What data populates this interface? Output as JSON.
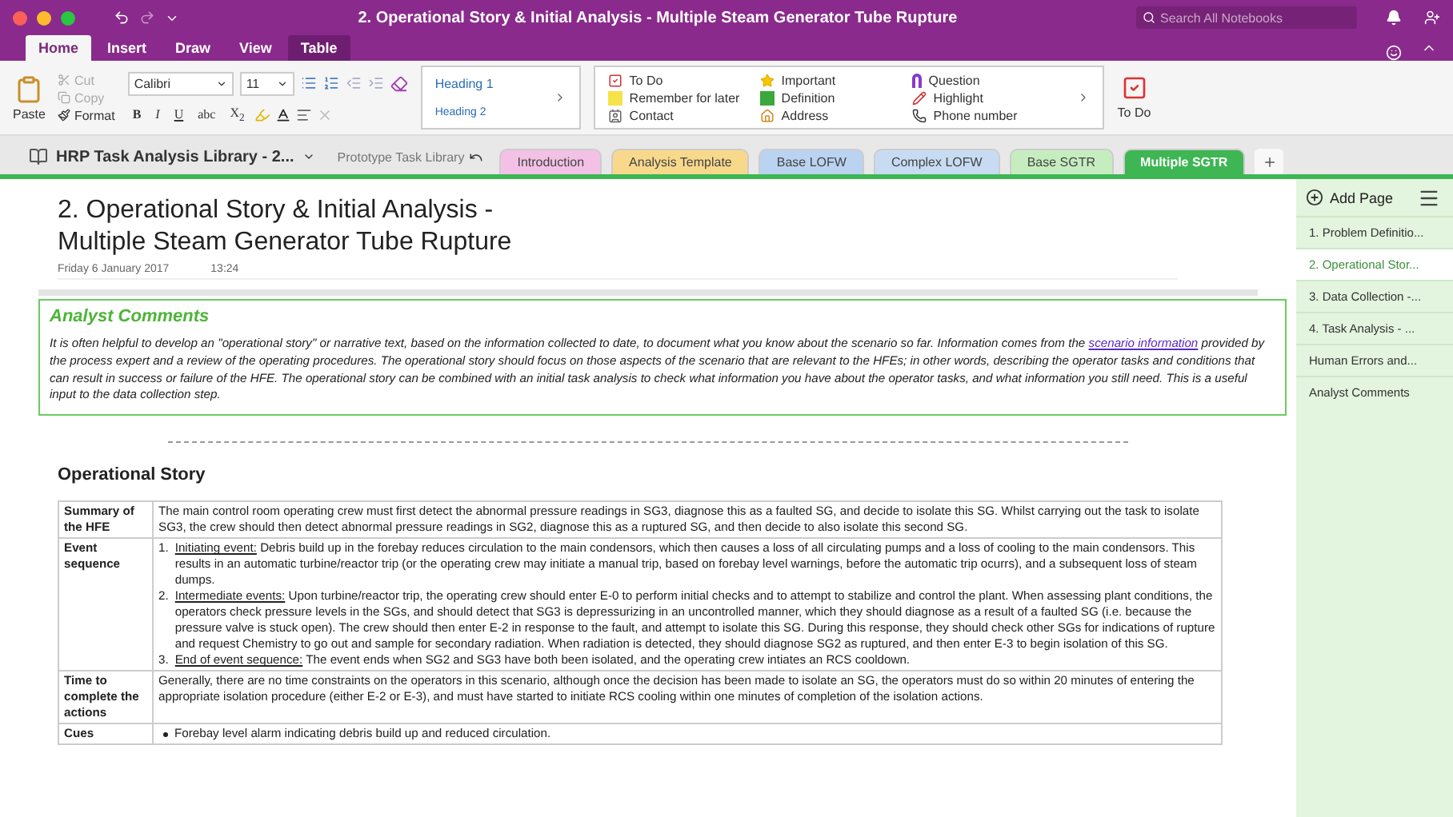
{
  "window": {
    "title": "2. Operational Story & Initial Analysis - Multiple Steam Generator Tube Rupture",
    "search_placeholder": "Search All Notebooks"
  },
  "ribbon_tabs": [
    {
      "label": "Home",
      "selected": true
    },
    {
      "label": "Insert",
      "selected": false
    },
    {
      "label": "Draw",
      "selected": false
    },
    {
      "label": "View",
      "selected": false
    },
    {
      "label": "Table",
      "selected": false,
      "kind": "contextual"
    }
  ],
  "clipboard": {
    "paste": "Paste",
    "cut": "Cut",
    "copy": "Copy",
    "format": "Format"
  },
  "font": {
    "name": "Calibri",
    "size": "11",
    "buttons": [
      "B",
      "I",
      "U",
      "abc",
      "X$_{2}$"
    ]
  },
  "styles": [
    "Heading 1",
    "Heading 2"
  ],
  "tags": [
    {
      "label": "To Do"
    },
    {
      "label": "Remember for later"
    },
    {
      "label": "Contact"
    },
    {
      "label": "Important"
    },
    {
      "label": "Definition"
    },
    {
      "label": "Address"
    },
    {
      "label": "Question"
    },
    {
      "label": "Highlight"
    },
    {
      "label": "Phone number"
    }
  ],
  "todo_button": "To Do",
  "notebook": {
    "name": "HRP Task Analysis Library - 2...",
    "section_group": "Prototype Task Library"
  },
  "sections": [
    {
      "label": "Introduction",
      "color": "#f3c1e6",
      "selected": false
    },
    {
      "label": "Analysis Template",
      "color": "#f8d98c",
      "selected": false
    },
    {
      "label": "Base LOFW",
      "color": "#b9d3f0",
      "selected": false
    },
    {
      "label": "Complex LOFW",
      "color": "#c7dcf3",
      "selected": false
    },
    {
      "label": "Base SGTR",
      "color": "#c6edc0",
      "selected": false
    },
    {
      "label": "Multiple SGTR",
      "color": "#3db653",
      "selected": true
    }
  ],
  "page": {
    "title_lines": [
      "2. Operational Story & Initial Analysis -",
      "Multiple Steam Generator Tube Rupture"
    ],
    "date": "Friday 6 January 2017",
    "time": "13:24",
    "comments": {
      "heading": "Analyst Comments",
      "before": "It is often helpful to develop an \"operational story\" or narrative text, based on the information collected to date, to document what you know about the scenario so far. Information comes from the",
      "link": "scenario information",
      "after": "provided by the process expert and a review of the operating procedures. The operational story should focus on those aspects of the scenario that are relevant to the HFEs; in other words, describing the operator tasks and conditions that can result in success or failure of the HFE.  The operational story can be combined with an initial task analysis to check what information you have about the operator tasks, and what information you still need. This is a useful input to the data collection step."
    },
    "section_heading": "Operational Story",
    "rows": [
      {
        "label": "Summary of the HFE",
        "kind": "text",
        "text": "The main control room operating crew must first detect the abnormal pressure readings in SG3, diagnose this as a faulted SG, and decide to isolate this SG. Whilst carrying out the task to isolate SG3, the crew should then detect abnormal pressure readings in SG2, diagnose this as a ruptured SG, and then decide to also isolate this second SG."
      },
      {
        "label": "Event sequence",
        "kind": "numbered",
        "items": [
          {
            "number": "1.",
            "label": "Initiating event:",
            "text": "Debris build up in the forebay reduces circulation to the main condensors, which then causes a loss of all circulating pumps and a loss of cooling to the main condensors. This results in an automatic turbine/reactor trip (or the operating crew may initiate a manual trip, based on forebay level warnings, before the automatic trip ocurrs), and a subsequent loss of steam dumps."
          },
          {
            "number": "2.",
            "label": "Intermediate events:",
            "text": "Upon turbine/reactor trip, the operating crew should enter E-0 to perform initial checks and to attempt to stabilize and control the plant. When assessing plant conditions, the operators check pressure levels in the SGs, and should detect that SG3 is depressurizing in an uncontrolled manner, which they should diagnose as a result of a faulted SG (i.e. because the pressure valve is stuck open). The crew should then enter E-2 in response to the fault, and attempt to isolate this SG. During this response, they should check other SGs for indications of rupture and request Chemistry to go out and sample for secondary radiation. When radiation is detected, they should diagnose SG2 as ruptured, and then enter E-3 to begin isolation of this SG."
          },
          {
            "number": "3.",
            "label": "End of event sequence:",
            "text": "The event ends when SG2 and SG3 have both been isolated, and the operating crew intiates an RCS cooldown."
          }
        ]
      },
      {
        "label": "Time to complete the actions",
        "kind": "text",
        "text": "Generally, there are no time constraints on the operators in this scenario, although once the decision has been made to isolate an SG, the operators must do so within 20 minutes of entering the appropriate isolation procedure (either E-2 or E-3), and must have started to initiate RCS cooling within one minutes of completion of the isolation actions."
      },
      {
        "label": "Cues",
        "kind": "bullets",
        "items": [
          "Forebay level alarm indicating debris build up and reduced circulation."
        ]
      }
    ]
  },
  "sidebar": {
    "add_page": "Add Page",
    "pages": [
      {
        "label": "1. Problem Definitio...",
        "selected": false
      },
      {
        "label": "2. Operational Stor...",
        "selected": true
      },
      {
        "label": "3. Data Collection -...",
        "selected": false
      },
      {
        "label": "4. Task Analysis - ...",
        "selected": false
      },
      {
        "label": "Human Errors and...",
        "selected": false
      },
      {
        "label": "Analyst Comments",
        "selected": false
      }
    ]
  }
}
